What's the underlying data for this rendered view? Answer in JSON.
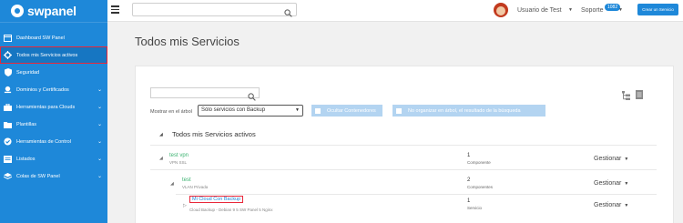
{
  "logo": {
    "text": "swpanel"
  },
  "sidebar": {
    "items": [
      {
        "label": "Dashboard SW Panel",
        "icon": "dashboard-icon",
        "has_chevron": false
      },
      {
        "label": "Todos mis Servicios activos",
        "icon": "gear-icon",
        "has_chevron": false,
        "active": true
      },
      {
        "label": "Seguridad",
        "icon": "shield-icon",
        "has_chevron": false
      },
      {
        "label": "Dominios y Certificados",
        "icon": "globe-icon",
        "has_chevron": true
      },
      {
        "label": "Herramientas para Clouds",
        "icon": "briefcase-icon",
        "has_chevron": true
      },
      {
        "label": "Plantillas",
        "icon": "folder-icon",
        "has_chevron": true
      },
      {
        "label": "Herramientas de Control",
        "icon": "check-circle-icon",
        "has_chevron": true
      },
      {
        "label": "Listados",
        "icon": "list-icon",
        "has_chevron": true
      },
      {
        "label": "Colas de SW Panel",
        "icon": "stack-icon",
        "has_chevron": true
      }
    ]
  },
  "topbar": {
    "search_placeholder": "",
    "user_name": "Usuario de Test",
    "support_label": "Soporte",
    "support_badge": "1082",
    "create_button": "Crear un Servicio"
  },
  "main": {
    "title": "Todos mis Servicios",
    "show_in_tree_label": "Mostrar en el árbol",
    "filter_selected": "Sólo servicios con Backup",
    "toggle_hide": "Ocultar Contenedores",
    "toggle_no_organize": "No organizar en árbol, el resultado de la búsqueda",
    "section_title": "Todos mis Servicios activos",
    "rows": [
      {
        "name": "test vpn",
        "sub": "VPN SSL",
        "count": "1",
        "count_type": "Componente",
        "manage": "Gestionar"
      },
      {
        "name": "test",
        "sub": "VLAN Privada",
        "count": "2",
        "count_type": "Componentes",
        "manage": "Gestionar"
      },
      {
        "name": "Mi Cloud Con Backup",
        "sub": "Cloud Backup - Debian 9 5 SW Panel 5 Nginx",
        "count": "1",
        "count_type": "Servicio",
        "manage": "Gestionar"
      }
    ]
  },
  "colors": {
    "sidebar": "#1e88d9",
    "accent": "#1e88d9",
    "highlight": "#e8283a",
    "service_green": "#3cb371"
  }
}
